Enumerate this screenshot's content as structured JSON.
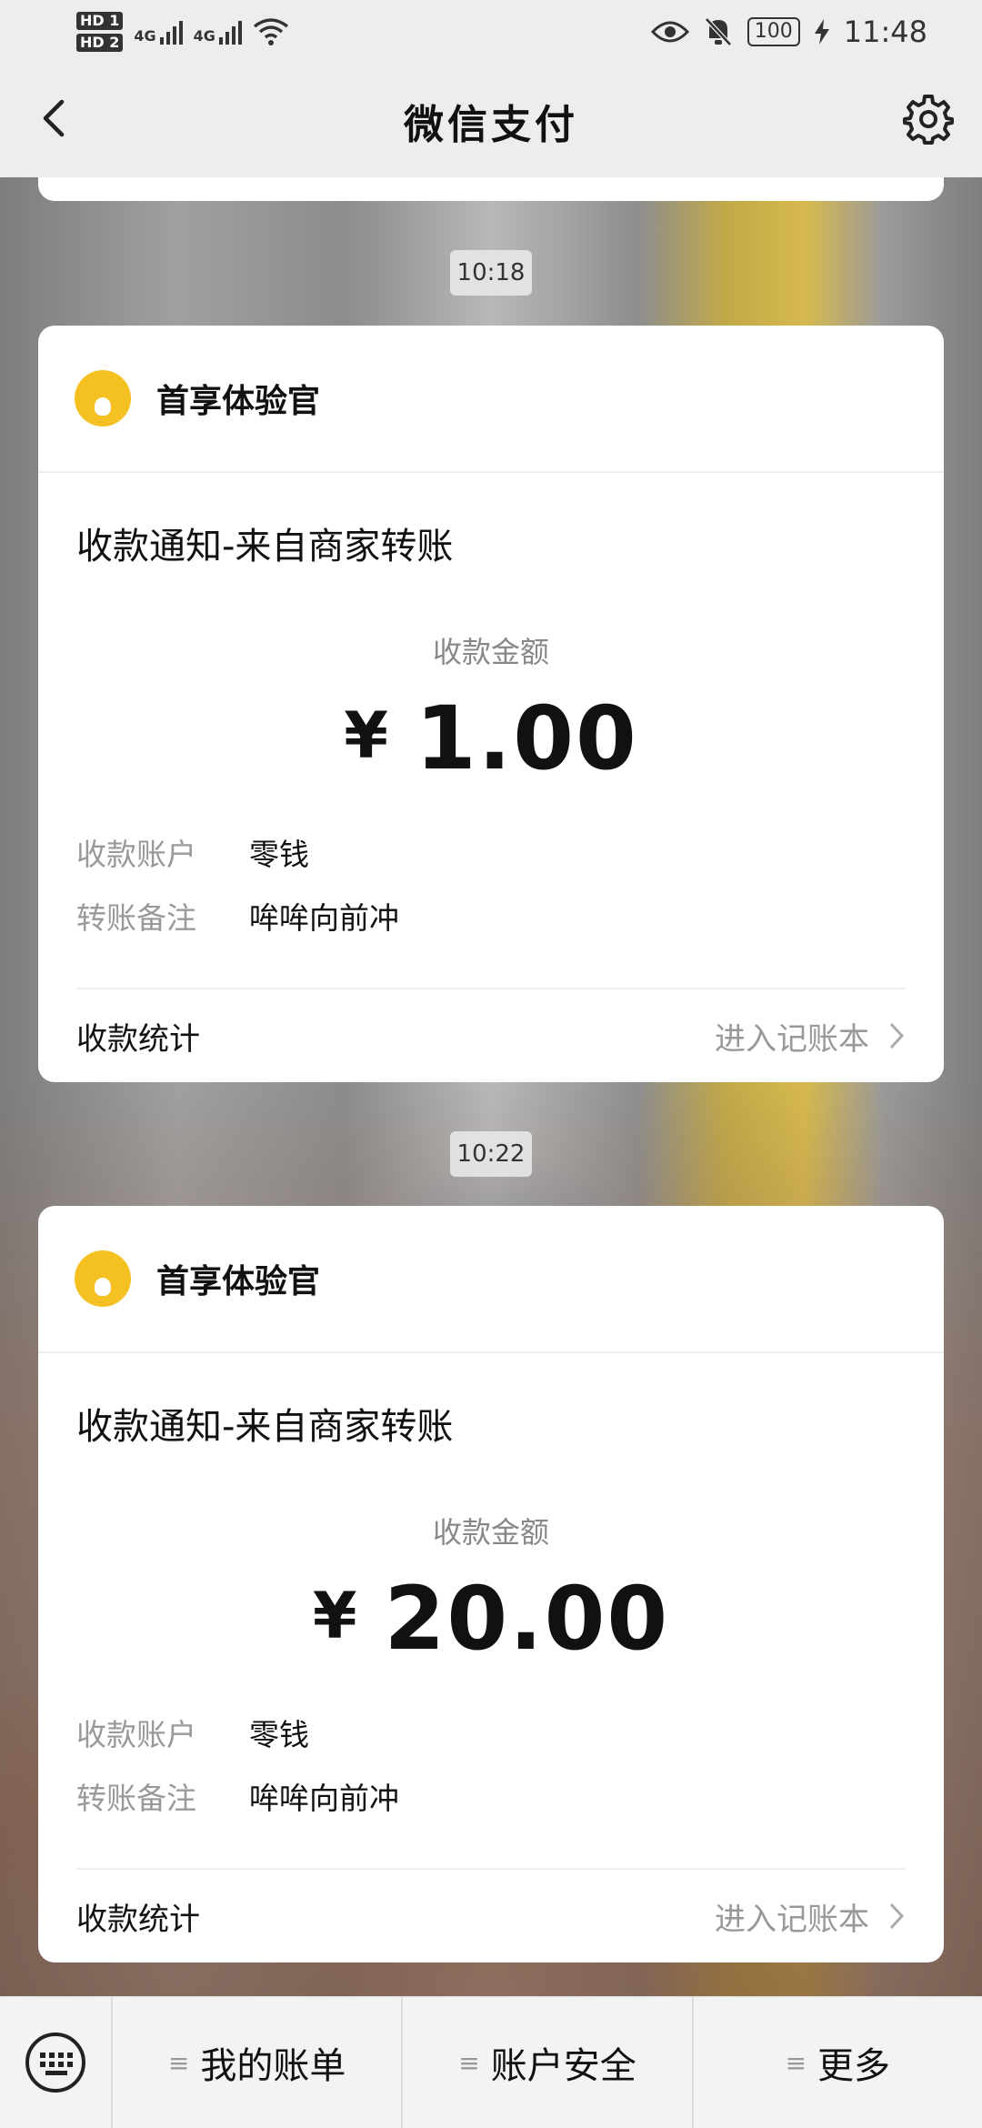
{
  "status_bar": {
    "sim1": "HD 1",
    "sim2": "HD 2",
    "net1": "4G",
    "net2": "4G",
    "battery": "100",
    "time": "11:48",
    "icons": [
      "eye-icon",
      "bell-muted-icon",
      "charging-icon",
      "wifi-icon"
    ]
  },
  "header": {
    "title": "微信支付",
    "back_icon": "chevron-left-icon",
    "settings_icon": "gear-icon"
  },
  "messages": [
    {
      "time": "10:18",
      "merchant": "首享体验官",
      "title": "收款通知-来自商家转账",
      "amount_label": "收款金额",
      "currency": "¥",
      "amount": "1.00",
      "account_key": "收款账户",
      "account_value": "零钱",
      "note_key": "转账备注",
      "note_value": "哞哞向前冲",
      "stats_label": "收款统计",
      "ledger_link": "进入记账本"
    },
    {
      "time": "10:22",
      "merchant": "首享体验官",
      "title": "收款通知-来自商家转账",
      "amount_label": "收款金额",
      "currency": "¥",
      "amount": "20.00",
      "account_key": "收款账户",
      "account_value": "零钱",
      "note_key": "转账备注",
      "note_value": "哞哞向前冲",
      "stats_label": "收款统计",
      "ledger_link": "进入记账本"
    }
  ],
  "bottom_menu": {
    "keyboard_icon": "keyboard-icon",
    "items": [
      {
        "label": "我的账单",
        "icon": "menu-lines-icon"
      },
      {
        "label": "账户安全",
        "icon": "menu-lines-icon"
      },
      {
        "label": "更多",
        "icon": "menu-lines-icon"
      }
    ]
  }
}
